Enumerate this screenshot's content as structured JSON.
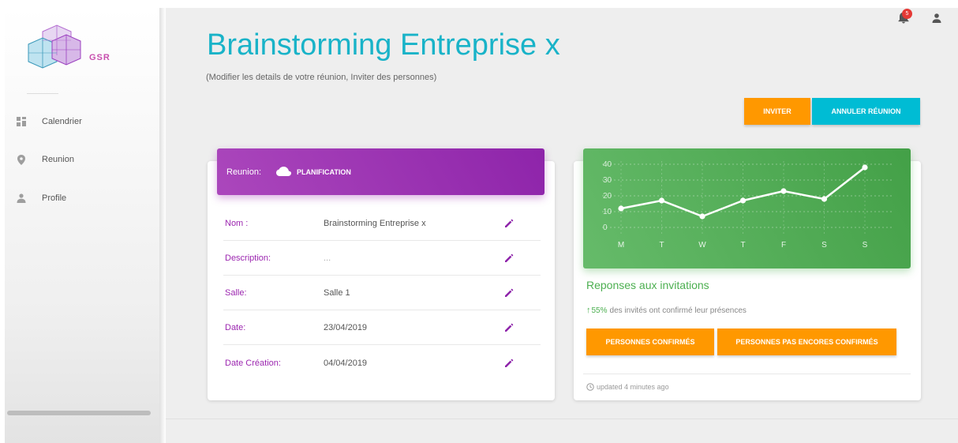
{
  "sidebar": {
    "logo_text": "GSR",
    "items": [
      {
        "label": "Calendrier",
        "icon": "dashboard-icon"
      },
      {
        "label": "Reunion",
        "icon": "location-pin-icon"
      },
      {
        "label": "Profile",
        "icon": "person-icon"
      }
    ]
  },
  "header": {
    "notification_count": "5",
    "title": "Brainstorming Entreprise x",
    "subtitle": "(Modifier les details de votre réunion, Inviter des personnes)"
  },
  "actions": {
    "invite": "INVITER",
    "cancel": "ANNULER RÉUNION"
  },
  "meeting_card": {
    "header_label": "Reunion:",
    "status": "PLANIFICATION",
    "rows": [
      {
        "label": "Nom :",
        "value": "Brainstorming Entreprise x"
      },
      {
        "label": "Description:",
        "value": "..."
      },
      {
        "label": "Salle:",
        "value": "Salle 1"
      },
      {
        "label": "Date:",
        "value": "23/04/2019"
      },
      {
        "label": "Date Création:",
        "value": "04/04/2019"
      }
    ]
  },
  "invitations_card": {
    "title": "Reponses aux invitations",
    "stat_percent": "55%",
    "stat_text": "des invités ont confirmé leur présences",
    "confirmed_button": "PERSONNES CONFIRMÉS",
    "unconfirmed_button": "PERSONNES PAS ENCORES CONFIRMÉS",
    "updated": "updated 4 minutes ago"
  },
  "colors": {
    "accent_cyan": "#19b3c8",
    "purple": "#9c27b0",
    "green": "#4caf50",
    "orange": "#ff9800"
  },
  "chart_data": {
    "type": "line",
    "categories": [
      "M",
      "T",
      "W",
      "T",
      "F",
      "S",
      "S"
    ],
    "series": [
      {
        "values": [
          12,
          17,
          7,
          17,
          23,
          18,
          38
        ]
      }
    ],
    "yticks": [
      0,
      10,
      20,
      30,
      40
    ],
    "ylim": [
      0,
      40
    ],
    "grid": true
  }
}
